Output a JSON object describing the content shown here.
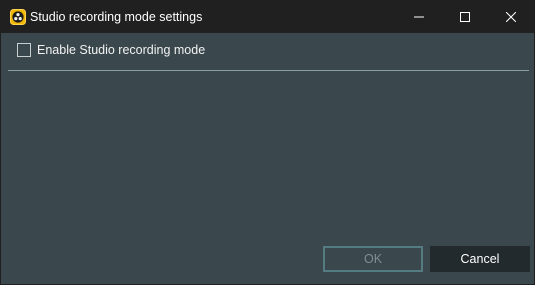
{
  "window": {
    "title": "Studio recording mode settings",
    "app_icon": "obs-icon",
    "controls": {
      "minimize_icon": "minimize-icon",
      "maximize_icon": "maximize-icon",
      "close_icon": "close-icon"
    }
  },
  "settings": {
    "enable_checkbox": {
      "label": "Enable Studio recording mode",
      "checked": false
    }
  },
  "footer": {
    "ok_label": "OK",
    "ok_enabled": false,
    "cancel_label": "Cancel"
  },
  "colors": {
    "titlebar": "#202020",
    "body": "#3a474c",
    "divider": "#8ba0a4",
    "ok_border": "#547b80",
    "cancel_bg": "#222a2d"
  }
}
